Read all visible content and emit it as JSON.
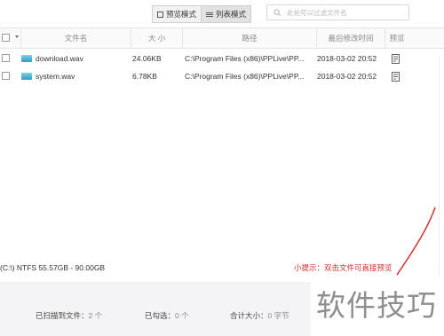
{
  "toolbar": {
    "preview_mode_label": "预览模式",
    "list_mode_label": "列表模式",
    "search_placeholder": "此处可以过滤文件名"
  },
  "table": {
    "columns": {
      "name": "文件名",
      "size": "大 小",
      "path": "路径",
      "modified": "最后修改时间",
      "preview": "预览"
    },
    "rows": [
      {
        "name": "download.wav",
        "size": "24.06KB",
        "path": "C:\\Program Files (x86)\\PPLive\\PP...",
        "modified": "2018-03-02 20:52"
      },
      {
        "name": "system.wav",
        "size": "6.78KB",
        "path": "C:\\Program Files (x86)\\PPLive\\PP...",
        "modified": "2018-03-02 20:52"
      }
    ]
  },
  "status": {
    "disk": "(C:\\) NTFS 55.57GB - 90.00GB",
    "tip": "小提示：双击文件可直接预览"
  },
  "footer": {
    "scanned_label": "已扫描到文件：",
    "scanned_value": "2 个",
    "selected_label": "已勾选：",
    "selected_value": "0 个",
    "total_label": "合计大小：",
    "total_value": "0 字节"
  },
  "watermark": "软件技巧",
  "colors": {
    "tip_red": "#c9302c",
    "footer_bg": "#f4f4f6",
    "wav_icon": "#2d9ec4"
  }
}
